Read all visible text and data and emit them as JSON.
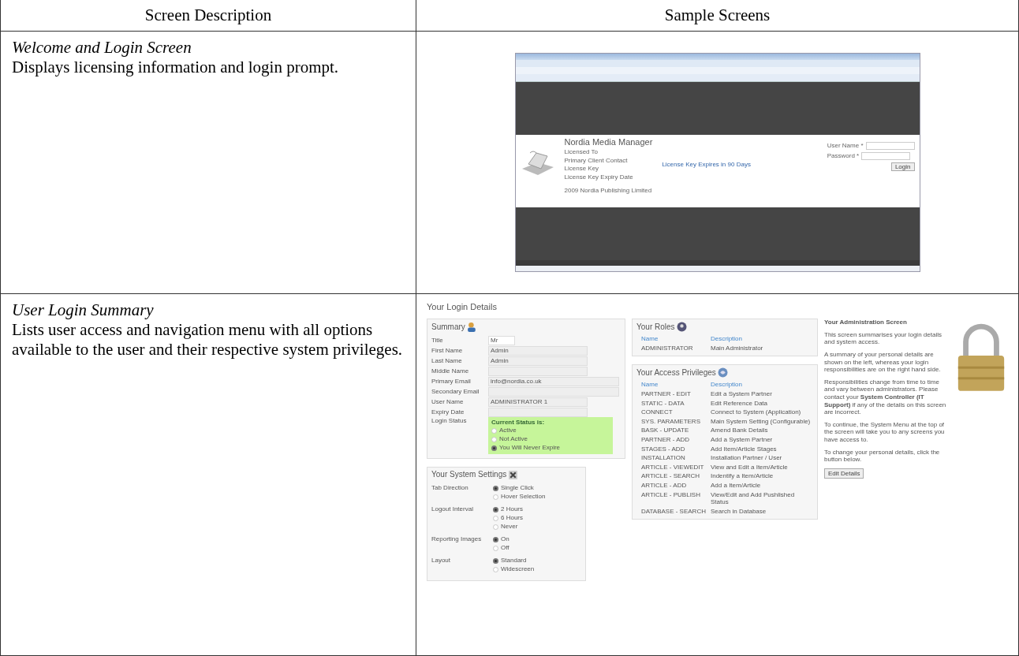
{
  "table": {
    "columns": [
      "Screen Description",
      "Sample Screens"
    ],
    "rows": [
      {
        "kind": "welcome",
        "title": "Welcome and Login Screen",
        "description": "Displays licensing information and login prompt.",
        "screen": {
          "app_title": "Nordia Media Manager",
          "info_labels": [
            "Licensed To",
            "Primary Client Contact",
            "License Key",
            "License Key Expiry Date"
          ],
          "copyright": "2009 Nordia Publishing Limited",
          "expiry_notice": "License Key Expires in 90 Days",
          "login_fields": [
            {
              "label": "User Name *"
            },
            {
              "label": "Password *"
            }
          ],
          "login_button": "Login"
        }
      },
      {
        "kind": "summary",
        "title": "User Login Summary",
        "description": "Lists user access and navigation menu with all options available to the user and their respective system privileges.",
        "screen": {
          "heading": "Your Login Details",
          "summary": {
            "title": "Summary",
            "fields": [
              {
                "kind": "select",
                "label": "Title",
                "value": "Mr"
              },
              {
                "kind": "text",
                "label": "First Name",
                "value": "Admin"
              },
              {
                "kind": "text",
                "label": "Last Name",
                "value": "Admin"
              },
              {
                "kind": "text",
                "label": "Middle Name"
              },
              {
                "kind": "wide",
                "label": "Primary Email",
                "value": "info@nordia.co.uk"
              },
              {
                "kind": "wide",
                "label": "Secondary Email"
              },
              {
                "kind": "text",
                "label": "User Name",
                "value": "ADMINISTRATOR 1"
              },
              {
                "kind": "text",
                "label": "Expiry Date"
              }
            ],
            "status_label": "Login Status",
            "status_heading": "Current Status is:",
            "status_options": [
              {
                "label": "Active",
                "selected": false
              },
              {
                "label": "Not Active",
                "selected": false
              },
              {
                "label": "You Will Never Expire",
                "selected": true
              }
            ]
          },
          "settings": {
            "title": "Your System Settings",
            "groups": [
              {
                "label": "Tab Direction",
                "options": [
                  {
                    "label": "Single Click",
                    "selected": true
                  },
                  {
                    "label": "Hover Selection",
                    "selected": false
                  }
                ]
              },
              {
                "label": "Logout Interval",
                "options": [
                  {
                    "label": "2 Hours",
                    "selected": true
                  },
                  {
                    "label": "6 Hours",
                    "selected": false
                  },
                  {
                    "label": "Never",
                    "selected": false
                  }
                ]
              },
              {
                "label": "Reporting Images",
                "options": [
                  {
                    "label": "On",
                    "selected": true
                  },
                  {
                    "label": "Off",
                    "selected": false
                  }
                ]
              },
              {
                "label": "Layout",
                "options": [
                  {
                    "label": "Standard",
                    "selected": true
                  },
                  {
                    "label": "Widescreen",
                    "selected": false
                  }
                ]
              }
            ]
          },
          "roles": {
            "title": "Your Roles",
            "columns": [
              "Name",
              "Description"
            ],
            "rows": [
              [
                "ADMINISTRATOR",
                "Main Administrator"
              ]
            ]
          },
          "privileges": {
            "title": "Your Access Privileges",
            "columns": [
              "Name",
              "Description"
            ],
            "rows": [
              [
                "PARTNER - EDIT",
                "Edit a System Partner"
              ],
              [
                "STATIC - DATA",
                "Edit Reference Data"
              ],
              [
                "CONNECT",
                "Connect to System (Application)"
              ],
              [
                "SYS. PARAMETERS",
                "Main System Setting (Configurable)"
              ],
              [
                "BASK - UPDATE",
                "Amend Bank Details"
              ],
              [
                "PARTNER - ADD",
                "Add a System Partner"
              ],
              [
                "STAGES - ADD",
                "Add Item/Article Stages"
              ],
              [
                "INSTALLATION",
                "Installation Partner / User"
              ],
              [
                "ARTICLE - VIEWEDIT",
                "View and Edit a Item/Article"
              ],
              [
                "ARTICLE - SEARCH",
                "Indentify a Item/Article"
              ],
              [
                "ARTICLE - ADD",
                "Add a Item/Article"
              ],
              [
                "ARTICLE - PUBLISH",
                "View/Edit and Add Pushlished Status"
              ],
              [
                "DATABASE - SEARCH",
                "Search in Database"
              ]
            ]
          },
          "help": {
            "title": "Your Administration Screen",
            "paragraphs": [
              "This screen summarises your login details and system access.",
              "A summary of your personal details are shown on the left, whereas your login responsibilities are on the right hand side.",
              "Responsibilities change from time to time and vary between administrators. Please contact your **System Controller (IT Support)** if any of the details on this screen are incorrect.",
              "To continue, the System Menu at the top of the screen will take you to any screens you have access to.",
              "To change your personal details, click the button below."
            ],
            "button": "Edit Details"
          }
        }
      }
    ]
  }
}
